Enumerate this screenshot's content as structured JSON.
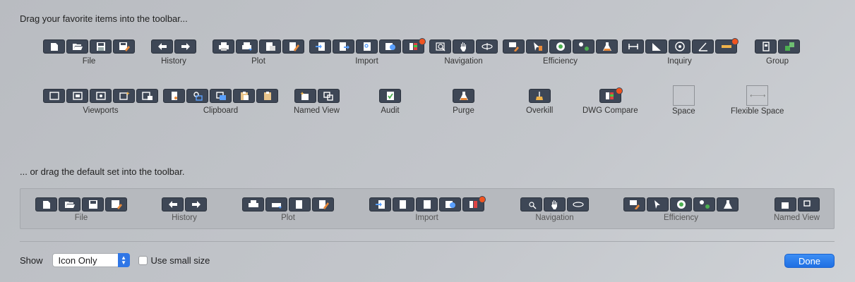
{
  "hint_favorites": "Drag your favorite items into the toolbar...",
  "hint_default": "... or drag the default set into the toolbar.",
  "colors": {
    "accent": "#2f76e6",
    "icon_bg": "#3e4756",
    "badge": "#f0541f"
  },
  "groups": {
    "file": "File",
    "history": "History",
    "plot": "Plot",
    "import": "Import",
    "navigation": "Navigation",
    "efficiency": "Efficiency",
    "inquiry": "Inquiry",
    "group": "Group",
    "viewports": "Viewports",
    "clipboard": "Clipboard",
    "named_view": "Named View",
    "audit": "Audit",
    "purge": "Purge",
    "overkill": "Overkill",
    "dwg_compare": "DWG Compare",
    "space": "Space",
    "flexible_space": "Flexible Space"
  },
  "default_set": {
    "file": "File",
    "history": "History",
    "plot": "Plot",
    "import": "Import",
    "navigation": "Navigation",
    "efficiency": "Efficiency",
    "named_view": "Named View"
  },
  "bottom": {
    "show_label": "Show",
    "show_value": "Icon Only",
    "small_size_label": "Use small size",
    "done_label": "Done"
  }
}
